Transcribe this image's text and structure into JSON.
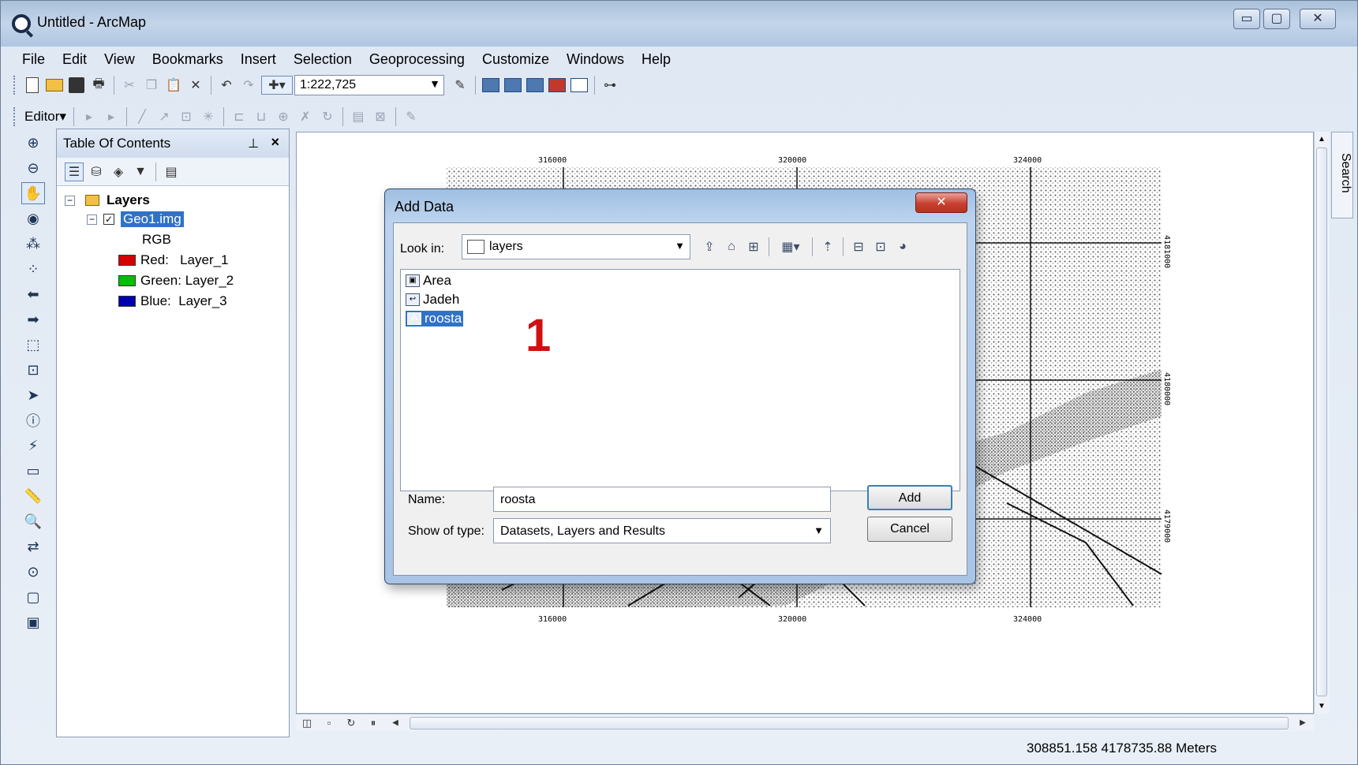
{
  "window": {
    "title": "Untitled - ArcMap",
    "minimize": "▭",
    "maximize": "▢",
    "close": "✕"
  },
  "menu": [
    "File",
    "Edit",
    "View",
    "Bookmarks",
    "Insert",
    "Selection",
    "Geoprocessing",
    "Customize",
    "Windows",
    "Help"
  ],
  "toolbar": {
    "scale": "1:222,725",
    "editor_label": "Editor▾"
  },
  "toc": {
    "title": "Table Of Contents",
    "root": "Layers",
    "layer": "Geo1.img",
    "renderer": "RGB",
    "bands": [
      {
        "label": "Red:   Layer_1",
        "color": "#d40000"
      },
      {
        "label": "Green: Layer_2",
        "color": "#00c000"
      },
      {
        "label": "Blue:  Layer_3",
        "color": "#0000b0"
      }
    ]
  },
  "map": {
    "top_labels": [
      "316000",
      "320000",
      "324000"
    ],
    "bottom_labels": [
      "316000",
      "320000",
      "324000"
    ],
    "right_labels": [
      "4181000",
      "4180000",
      "4179000"
    ]
  },
  "search_tab": "Search",
  "status": {
    "coordinates": "308851.158  4178735.88 Meters"
  },
  "dialog": {
    "title": "Add Data",
    "look_in_label": "Look in:",
    "look_in_value": "layers",
    "files": [
      "Area",
      "Jadeh",
      "roosta"
    ],
    "selected_file": "roosta",
    "step_marker": "1",
    "name_label": "Name:",
    "name_value": "roosta",
    "type_label": "Show of type:",
    "type_value": "Datasets, Layers and Results",
    "add_button": "Add",
    "cancel_button": "Cancel"
  }
}
